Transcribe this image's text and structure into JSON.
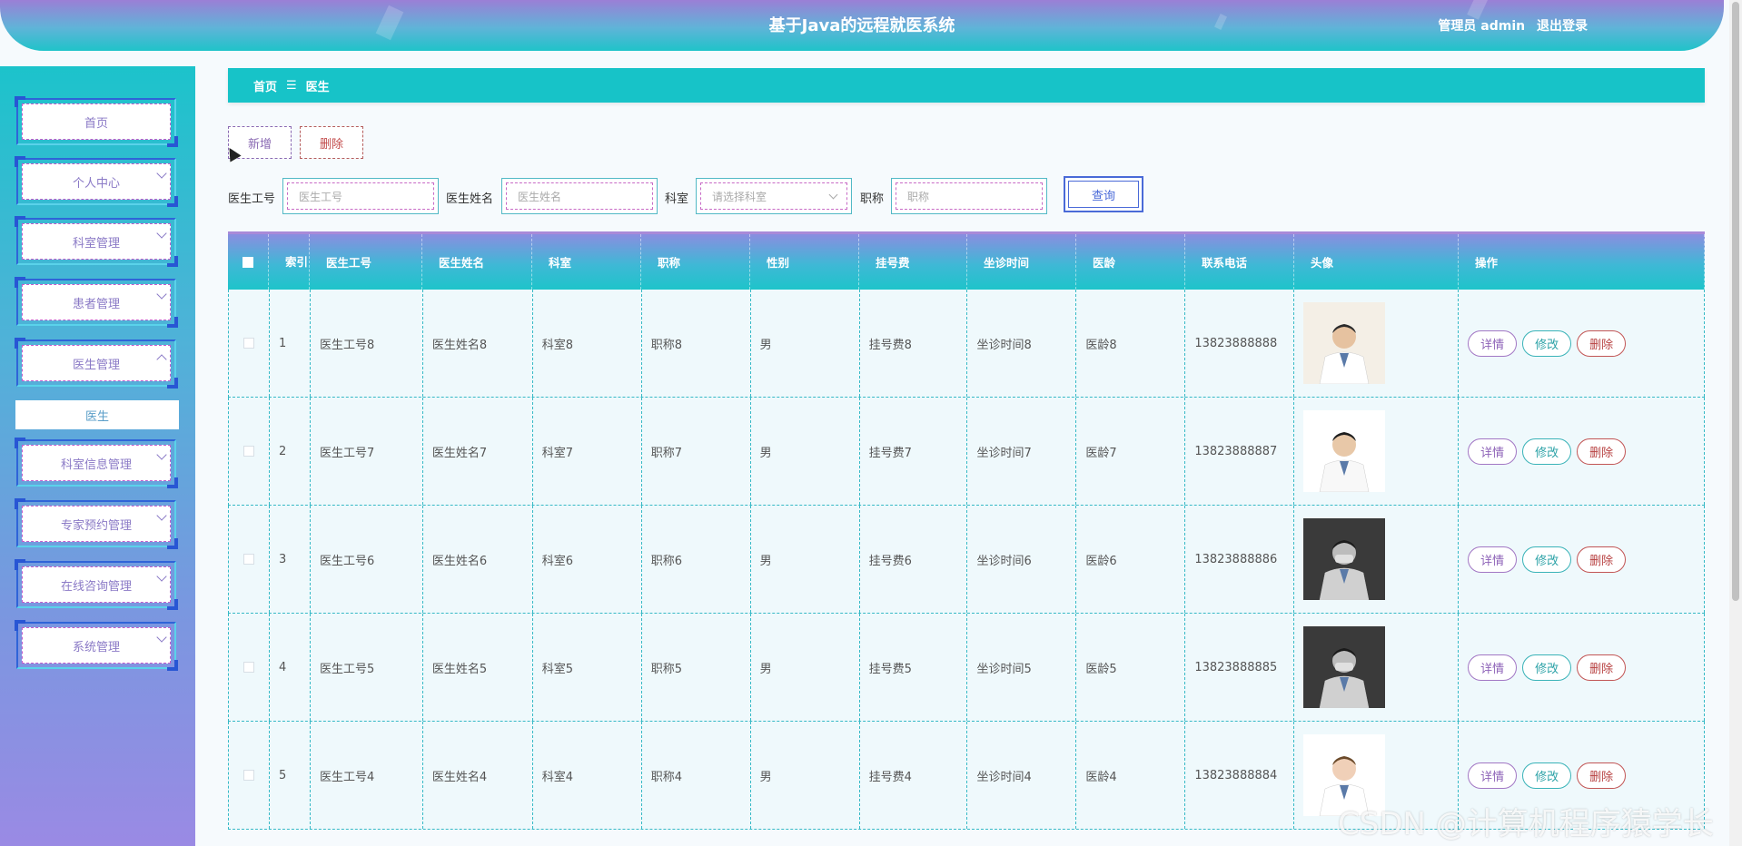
{
  "header": {
    "title": "基于Java的远程就医系统",
    "role": "管理员 admin",
    "logout": "退出登录"
  },
  "sidebar": {
    "items": [
      {
        "label": "首页",
        "expandable": false
      },
      {
        "label": "个人中心",
        "expandable": true
      },
      {
        "label": "科室管理",
        "expandable": true
      },
      {
        "label": "患者管理",
        "expandable": true
      },
      {
        "label": "医生管理",
        "expandable": true,
        "expanded": true
      },
      {
        "label": "科室信息管理",
        "expandable": true
      },
      {
        "label": "专家预约管理",
        "expandable": true
      },
      {
        "label": "在线咨询管理",
        "expandable": true
      },
      {
        "label": "系统管理",
        "expandable": true
      }
    ],
    "submenu": "医生"
  },
  "breadcrumb": {
    "home": "首页",
    "separator": "☰",
    "current": "医生"
  },
  "actions": {
    "add": "新增",
    "delete": "删除"
  },
  "search": {
    "doctor_id_label": "医生工号",
    "doctor_id_placeholder": "医生工号",
    "doctor_name_label": "医生姓名",
    "doctor_name_placeholder": "医生姓名",
    "dept_label": "科室",
    "dept_placeholder": "请选择科室",
    "title_label": "职称",
    "title_placeholder": "职称",
    "query": "查询"
  },
  "table": {
    "headers": [
      "",
      "索引",
      "医生工号",
      "医生姓名",
      "科室",
      "职称",
      "性别",
      "挂号费",
      "坐诊时间",
      "医龄",
      "联系电话",
      "头像",
      "操作"
    ],
    "rows": [
      {
        "index": "1",
        "id": "医生工号8",
        "name": "医生姓名8",
        "dept": "科室8",
        "title": "职称8",
        "gender": "男",
        "fee": "挂号费8",
        "time": "坐诊时间8",
        "age": "医龄8",
        "phone": "13823888888",
        "avatar": "doctor-photo"
      },
      {
        "index": "2",
        "id": "医生工号7",
        "name": "医生姓名7",
        "dept": "科室7",
        "title": "职称7",
        "gender": "男",
        "fee": "挂号费7",
        "time": "坐诊时间7",
        "age": "医龄7",
        "phone": "13823888887",
        "avatar": "doctor-photo"
      },
      {
        "index": "3",
        "id": "医生工号6",
        "name": "医生姓名6",
        "dept": "科室6",
        "title": "职称6",
        "gender": "男",
        "fee": "挂号费6",
        "time": "坐诊时间6",
        "age": "医龄6",
        "phone": "13823888886",
        "avatar": "doctor-photo"
      },
      {
        "index": "4",
        "id": "医生工号5",
        "name": "医生姓名5",
        "dept": "科室5",
        "title": "职称5",
        "gender": "男",
        "fee": "挂号费5",
        "time": "坐诊时间5",
        "age": "医龄5",
        "phone": "13823888885",
        "avatar": "doctor-photo"
      },
      {
        "index": "5",
        "id": "医生工号4",
        "name": "医生姓名4",
        "dept": "科室4",
        "title": "职称4",
        "gender": "男",
        "fee": "挂号费4",
        "time": "坐诊时间4",
        "age": "医龄4",
        "phone": "13823888884",
        "avatar": "doctor-photo"
      }
    ],
    "ops": {
      "detail": "详情",
      "edit": "修改",
      "delete": "删除"
    }
  },
  "watermark": "CSDN @计算机程序猿学长",
  "colors": {
    "accent": "#17c3c8",
    "header_top": "#9b7fd6",
    "sidebar_bottom": "#9a8ae4",
    "danger": "#b74040"
  }
}
